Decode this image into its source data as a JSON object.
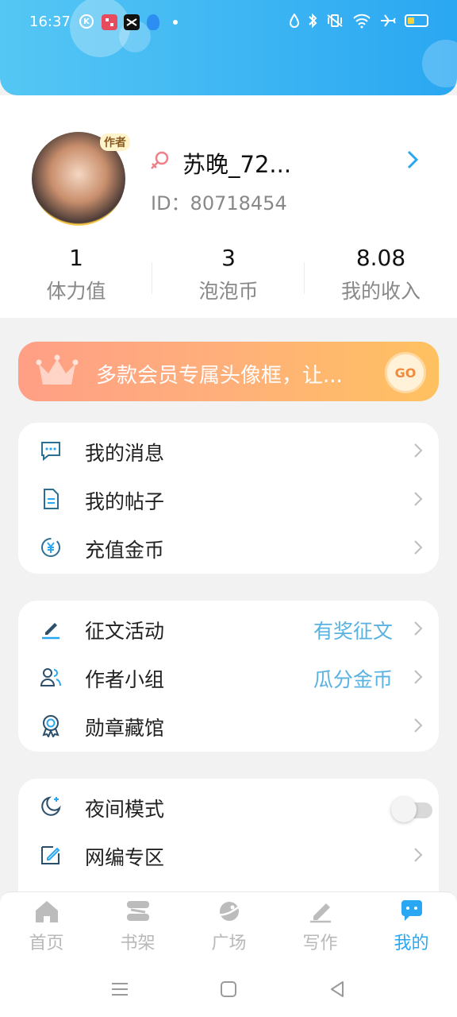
{
  "status_bar": {
    "time": "16:37",
    "notification_icons": [
      "k-app-icon",
      "red-app-icon",
      "capcut-icon",
      "qq-icon"
    ],
    "k_badge": "K",
    "right_icons": [
      "water-drop-icon",
      "bluetooth-icon",
      "vibrate-icon",
      "wifi-icon",
      "airplane-icon",
      "battery-icon"
    ],
    "battery_level": 0.2
  },
  "profile": {
    "avatar_tag": "作者",
    "username": "苏晚_72...",
    "user_id": "ID：80718454",
    "gender": "female"
  },
  "stats": [
    {
      "value": "1",
      "label": "体力值"
    },
    {
      "value": "3",
      "label": "泡泡币"
    },
    {
      "value": "8.08",
      "label": "我的收入"
    }
  ],
  "vip_banner": {
    "text": "多款会员专属头像框，让...",
    "go_label": "GO"
  },
  "menu_group_1": [
    {
      "label": "我的消息",
      "icon": "message-icon"
    },
    {
      "label": "我的帖子",
      "icon": "document-icon"
    },
    {
      "label": "充值金币",
      "icon": "yen-coin-icon"
    }
  ],
  "menu_group_2": [
    {
      "label": "征文活动",
      "extra": "有奖征文",
      "icon": "pen-icon"
    },
    {
      "label": "作者小组",
      "extra": "瓜分金币",
      "icon": "group-icon"
    },
    {
      "label": "勋章藏馆",
      "extra": "",
      "icon": "medal-icon"
    }
  ],
  "menu_group_3": [
    {
      "label": "夜间模式",
      "icon": "moon-icon",
      "toggle_on": false
    },
    {
      "label": "网编专区",
      "icon": "edit-icon"
    }
  ],
  "tabs": [
    {
      "label": "首页",
      "icon": "home-icon",
      "active": false
    },
    {
      "label": "书架",
      "icon": "bookshelf-icon",
      "active": false
    },
    {
      "label": "广场",
      "icon": "planet-icon",
      "active": false
    },
    {
      "label": "写作",
      "icon": "write-icon",
      "active": false
    },
    {
      "label": "我的",
      "icon": "chat-bubble-icon",
      "active": true
    }
  ],
  "colors": {
    "header_start": "#55c7f4",
    "header_end": "#2aa7f2",
    "accent": "#2aa7f2",
    "link_blue": "#5ab2e2",
    "banner_start": "#ff9f86",
    "banner_end": "#ffc160"
  }
}
